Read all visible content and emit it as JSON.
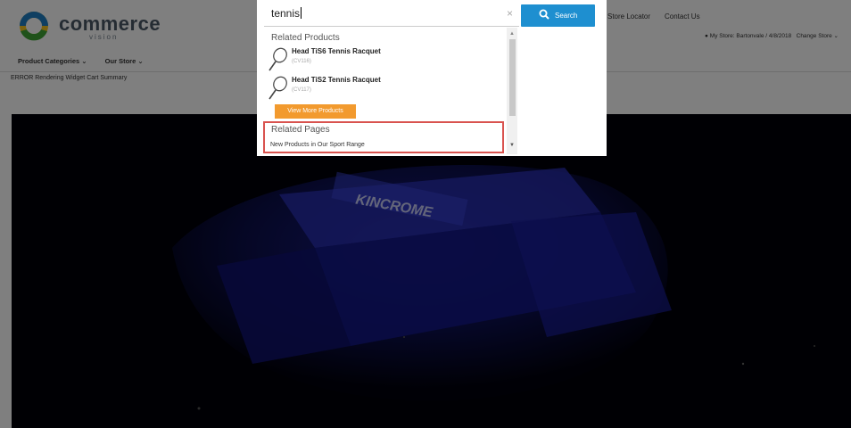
{
  "header": {
    "logo": {
      "name": "commerce",
      "sub": "vision"
    },
    "top_links": [
      "Store Locator",
      "Contact Us"
    ],
    "store_text": "My Store: Bartonvale / 4/8/2018",
    "change_store": "Change Store ⌄"
  },
  "nav": {
    "items": [
      "Product Categories ⌄",
      "Our Store ⌄"
    ]
  },
  "error_text": "ERROR Rendering Widget Cart Summary",
  "hero": {
    "brand": "KINCROME",
    "caption": ""
  },
  "search": {
    "value": "tennis",
    "clear": "×",
    "button_label": "Search"
  },
  "dropdown": {
    "related_products_title": "Related Products",
    "products": [
      {
        "name": "Head TiS6 Tennis Racquet",
        "code": "(CV116)"
      },
      {
        "name": "Head TiS2 Tennis Racquet",
        "code": "(CV117)"
      }
    ],
    "view_more_label": "View More Products",
    "related_pages_title": "Related Pages",
    "pages": [
      "New Products in Our Sport Range"
    ]
  },
  "colors": {
    "accent": "#1e8fd0",
    "orange": "#f29a2e",
    "highlight": "#d9534f"
  }
}
